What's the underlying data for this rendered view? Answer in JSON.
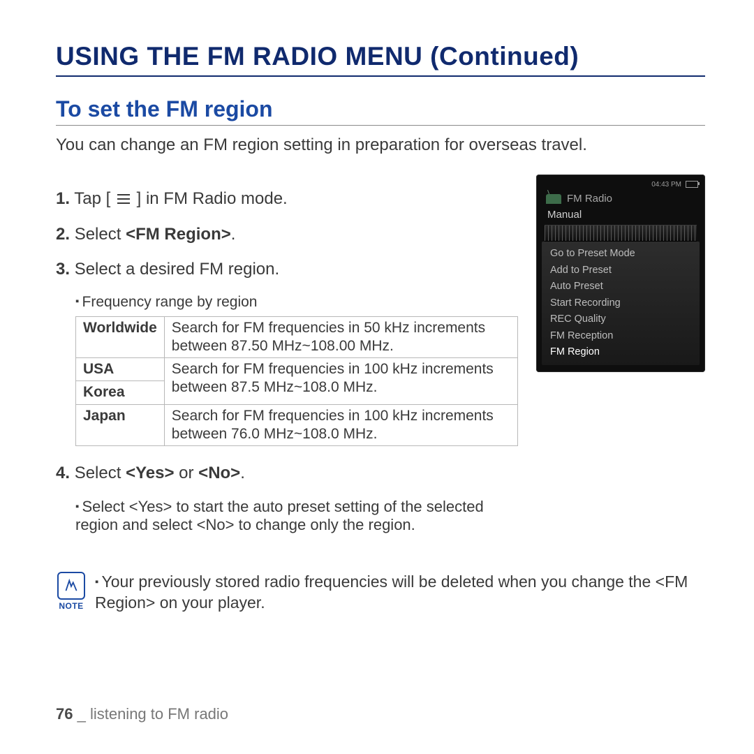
{
  "heading": "USING THE FM RADIO MENU (Continued)",
  "subheading": "To set the FM region",
  "intro": "You can change an FM region setting in preparation for overseas travel.",
  "steps": {
    "s1": {
      "num": "1.",
      "pre": "Tap [",
      "post": "] in FM Radio mode."
    },
    "s2": {
      "num": "2.",
      "txt": "Select ",
      "bold": "<FM Region>",
      "after": "."
    },
    "s3": {
      "num": "3.",
      "txt": "Select a desired FM region."
    },
    "s3_sub": "Frequency range by region",
    "s4": {
      "num": "4.",
      "txt": "Select ",
      "bold": "<Yes>",
      "mid": " or ",
      "bold2": "<No>",
      "after": "."
    },
    "s4_sub": "Select <Yes> to start the auto preset setting of the selected region and select <No> to change only the region."
  },
  "table": {
    "r1": {
      "region": "Worldwide",
      "desc": "Search for FM frequencies in 50 kHz increments between 87.50 MHz~108.00 MHz."
    },
    "r2": {
      "region": "USA",
      "desc": "Search for FM frequencies in 100 kHz increments between 87.5 MHz~108.0 MHz."
    },
    "r3": {
      "region": "Korea"
    },
    "r4": {
      "region": "Japan",
      "desc": "Search for FM frequencies in 100 kHz increments between 76.0 MHz~108.0 MHz."
    }
  },
  "note": {
    "label": "NOTE",
    "text": "Your previously stored radio frequencies will be deleted when you change the <FM Region> on your player."
  },
  "footer": {
    "page": "76",
    "sep": " _ ",
    "section": "listening to FM radio"
  },
  "device": {
    "time": "04:43 PM",
    "title": "FM Radio",
    "mode": "Manual",
    "menu": [
      "Go to Preset Mode",
      "Add to Preset",
      "Auto Preset",
      "Start Recording",
      "REC Quality",
      "FM Reception",
      "FM Region"
    ]
  }
}
